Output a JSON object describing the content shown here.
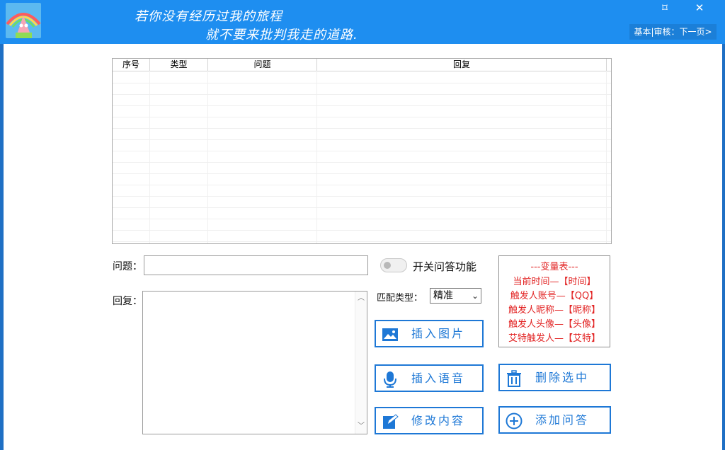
{
  "window": {
    "slogan_line1": "若你没有经历过我的旅程",
    "slogan_line2": "就不要来批判我走的道路.",
    "pin_glyph": "⌑",
    "close_glyph": "✕",
    "page_nav": "基本|审核：下一页>"
  },
  "table": {
    "columns": [
      "序号",
      "类型",
      "问题",
      "回复"
    ]
  },
  "form": {
    "question_label": "问题：",
    "question_value": "",
    "reply_label": "回复：",
    "reply_value": "",
    "toggle_label": "开关问答功能",
    "toggle_on": false,
    "match_label": "匹配类型：",
    "match_value": "精准"
  },
  "variables": {
    "title": "---变量表---",
    "items": [
      "当前时间—【时间】",
      "触发人账号—【QQ】",
      "触发人昵称—【昵称】",
      "触发人头像—【头像】",
      "艾特触发人—【艾特】"
    ]
  },
  "actions": {
    "insert_image": "插入图片",
    "insert_voice": "插入语音",
    "modify_content": "修改内容",
    "delete_selected": "删除选中",
    "add_qa": "添加问答"
  },
  "colors": {
    "titlebar": "#1e8ef0",
    "accent": "#1e78d6",
    "variable_text": "#e22424"
  }
}
